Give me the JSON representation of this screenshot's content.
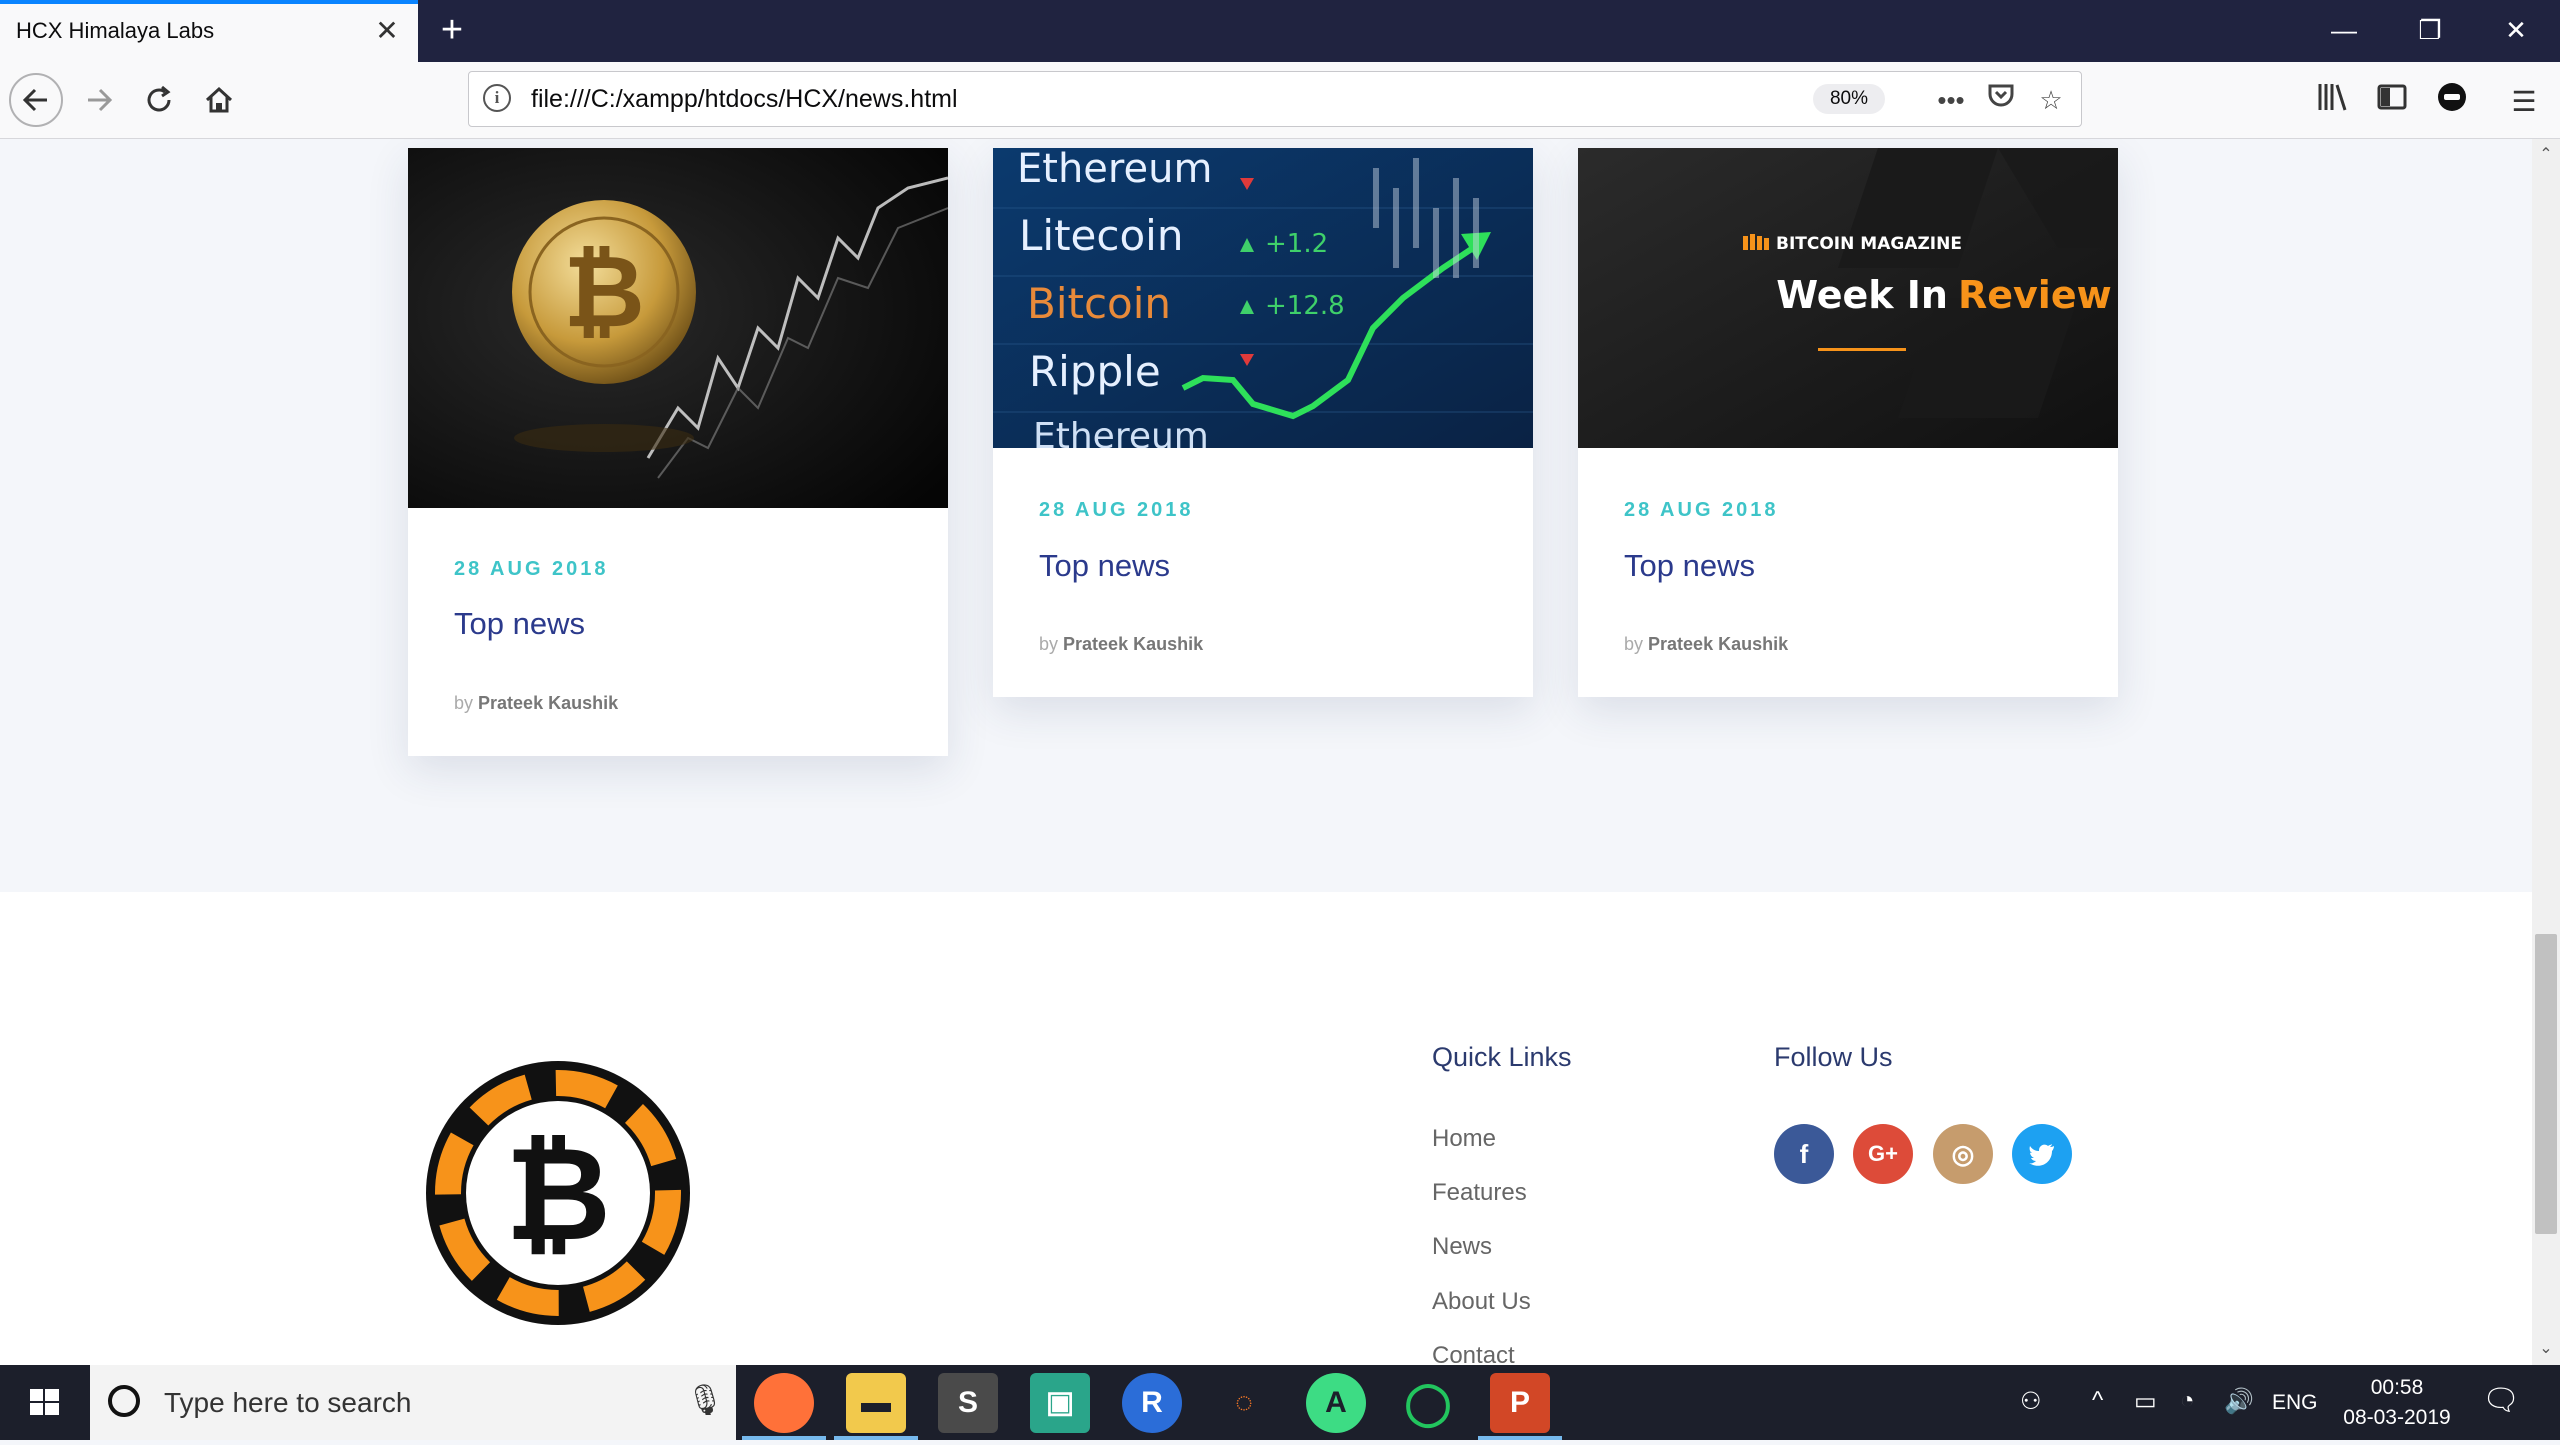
{
  "browser": {
    "tab_title": "HCX Himalaya Labs",
    "url": "file:///C:/xampp/htdocs/HCX/news.html",
    "zoom": "80%"
  },
  "news": {
    "cards": [
      {
        "date": "28 AUG 2018",
        "title": "Top news",
        "by": "by",
        "author": "Prateek Kaushik"
      },
      {
        "date": "28 AUG 2018",
        "title": "Top news",
        "by": "by",
        "author": "Prateek Kaushik"
      },
      {
        "date": "28 AUG 2018",
        "title": "Top news",
        "by": "by",
        "author": "Prateek Kaushik"
      }
    ],
    "card2_image": {
      "rows": [
        "Ethereum",
        "Litecoin",
        "Bitcoin",
        "Ripple",
        "Ethereum"
      ],
      "deltas": [
        "+1.2",
        "+12.8"
      ]
    },
    "card3_image": {
      "brand": "BITCOIN MAGAZINE",
      "line1": "Week In",
      "line2": "Review"
    }
  },
  "footer": {
    "quick_links_title": "Quick Links",
    "quick_links": [
      "Home",
      "Features",
      "News",
      "About Us",
      "Contact"
    ],
    "follow_title": "Follow Us",
    "social": [
      {
        "name": "facebook",
        "glyph": "f",
        "color": "#3b5998"
      },
      {
        "name": "google-plus",
        "glyph": "G+",
        "color": "#dd4b39"
      },
      {
        "name": "instagram",
        "glyph": "◎",
        "color": "#c69c6d"
      },
      {
        "name": "twitter",
        "glyph": "🐦",
        "color": "#1da1f2"
      }
    ]
  },
  "taskbar": {
    "search_placeholder": "Type here to search",
    "lang": "ENG",
    "time": "00:58",
    "date": "08-03-2019"
  },
  "colors": {
    "accent": "#3ec4c8",
    "title": "#2b3a8c",
    "chrome": "#202340",
    "bitcoin_orange": "#f7931a"
  }
}
